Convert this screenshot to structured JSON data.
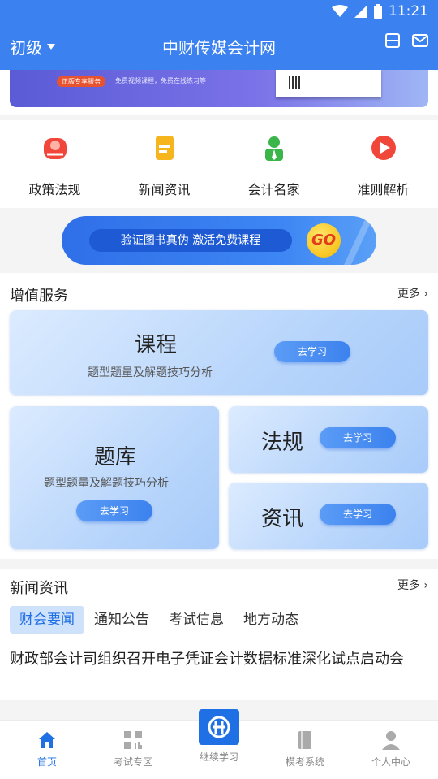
{
  "status_bar": {
    "time": "11:21"
  },
  "app_bar": {
    "level": "初级",
    "title": "中财传媒会计网"
  },
  "banner": {
    "pill": "正版专享服务",
    "text": "免费视频课程，免费在线练习等"
  },
  "quick_entries": [
    {
      "label": "政策法规",
      "icon": "policy-icon",
      "color": "#f0473a"
    },
    {
      "label": "新闻资讯",
      "icon": "news-icon",
      "color": "#f6b51d"
    },
    {
      "label": "会计名家",
      "icon": "expert-icon",
      "color": "#39b54a"
    },
    {
      "label": "准则解析",
      "icon": "play-icon",
      "color": "#f0473a"
    }
  ],
  "verify": {
    "text": "验证图书真伪   激活免费课程",
    "go": "GO"
  },
  "value_services": {
    "title": "增值服务",
    "more": "更多",
    "cards": [
      {
        "title": "课程",
        "subtitle": "题型题量及解题技巧分析",
        "button": "去学习"
      },
      {
        "title": "题库",
        "subtitle": "题型题量及解题技巧分析",
        "button": "去学习"
      },
      {
        "title": "法规",
        "button": "去学习"
      },
      {
        "title": "资讯",
        "button": "去学习"
      }
    ]
  },
  "news": {
    "title": "新闻资讯",
    "more": "更多",
    "tabs": [
      "财会要闻",
      "通知公告",
      "考试信息",
      "地方动态"
    ],
    "active_tab": "财会要闻",
    "headline": "财政部会计司组织召开电子凭证会计数据标准深化试点启动会"
  },
  "tab_bar": [
    {
      "label": "首页",
      "icon": "home-icon",
      "active": true
    },
    {
      "label": "考试专区",
      "icon": "grid-icon"
    },
    {
      "label": "继续学习",
      "icon": "logo-icon"
    },
    {
      "label": "模考系统",
      "icon": "book-icon"
    },
    {
      "label": "个人中心",
      "icon": "person-icon"
    }
  ],
  "colors": {
    "primary": "#3b82f0",
    "accent": "#1f6fe5"
  }
}
